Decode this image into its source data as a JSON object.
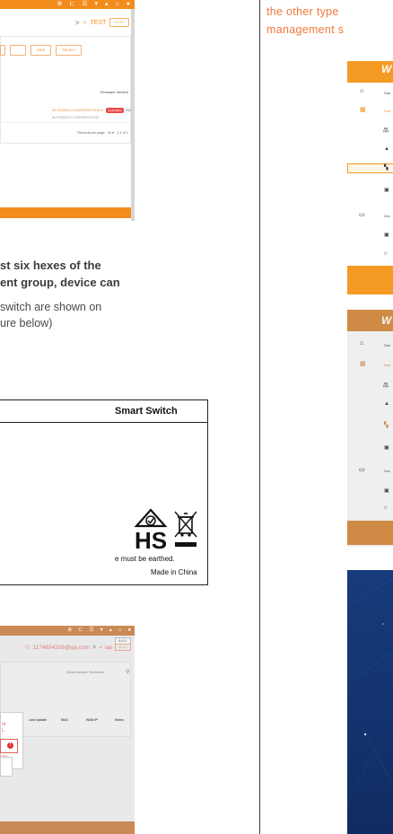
{
  "top_left_screenshot": {
    "ssid": "TEST",
    "reset_label": "RESET",
    "buttons": [
      "",
      "",
      "WEB",
      "TELNET"
    ],
    "firmware_header": "Firmware Version",
    "row1_model": "WI-PCE5510-LV100005PE7241022",
    "row1_badge": "Upgradable",
    "row1_extra": "202",
    "row2_model": "WI-PCE5510-P-V100005PE7241022",
    "rows_per_page_label": "Records per page:",
    "rows_per_page_value": "20",
    "range_label": "1-1 of 1"
  },
  "left_text": {
    "bold_line1": "st six hexes of the",
    "bold_line2": "ent group, device can",
    "line1": "switch are shown on",
    "line2": "ure below)"
  },
  "label_box": {
    "title": "Smart Switch",
    "earth_note": "e must be earthed.",
    "made_in": "Made in China",
    "rohs_partial": "HS"
  },
  "bottom_left_screenshot": {
    "user_email": "1174634208@qq.com",
    "ssid": "sai",
    "reset_label": "RESET",
    "back_label": "BACK",
    "serial_placeholder": "Serial number, Nickname",
    "columns": [
      "Last update",
      "MAC",
      "WAN IP",
      "Notes"
    ],
    "modal_line1": "nt",
    "modal_line2": "L.",
    "error_hint": "e MAC"
  },
  "right_top_text": {
    "line1": "the other type",
    "line2": "management s"
  },
  "sidebar_a": {
    "logo": "W",
    "items": [
      "Das",
      "Ove",
      "",
      "",
      "",
      "",
      "Dev",
      "",
      ""
    ]
  },
  "sidebar_b": {
    "logo": "W",
    "items": [
      "Das",
      "Ove",
      "",
      "",
      "",
      "",
      "Dev",
      "",
      ""
    ]
  },
  "colors": {
    "brand_orange": "#f28c1c",
    "accent_text_orange": "#ef7a3a",
    "muted_orange": "#c98a55",
    "navy": "#173a7a"
  }
}
